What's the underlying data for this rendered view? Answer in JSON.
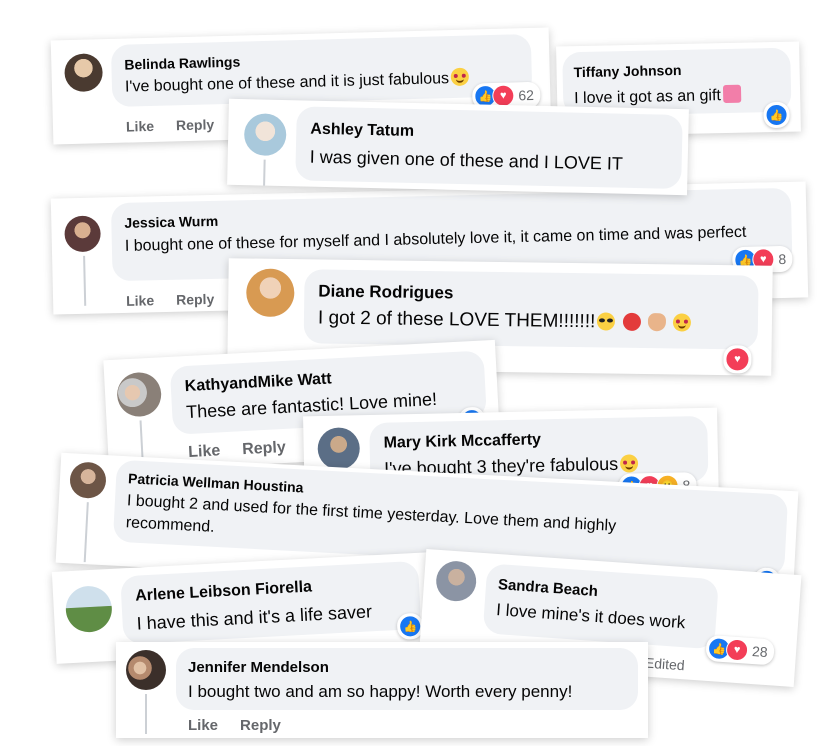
{
  "actions": {
    "like": "Like",
    "reply": "Reply"
  },
  "comments": [
    {
      "name": "Belinda Rawlings",
      "text": "I've bought one of these and it is just fabulous",
      "count": "62"
    },
    {
      "name": "Tiffany Johnson",
      "text": "I love it got as an gift"
    },
    {
      "name": "Ashley Tatum",
      "text": "I was given one of these and I LOVE IT"
    },
    {
      "name": "Jessica Wurm",
      "text": "I bought one of these for myself and I absolutely love it, it came on time and was perfect",
      "count": "8"
    },
    {
      "name": "Diane Rodrigues",
      "text": "I got 2 of these LOVE THEM!!!!!!!"
    },
    {
      "name": "KathyandMike Watt",
      "text": "These are fantastic! Love mine!"
    },
    {
      "name": "Mary Kirk Mccafferty",
      "text": "I've bought 3 they're fabulous",
      "count": "8"
    },
    {
      "name": "Patricia Wellman Houstina",
      "text": "I bought 2 and used for the first time yesterday. Love them and highly recommend."
    },
    {
      "name": "Arlene Leibson Fiorella",
      "text": "I have this and it's a life saver"
    },
    {
      "name": "Sandra Beach",
      "text": "I love mine's it does work",
      "count": "28",
      "edited": "Edited"
    },
    {
      "name": "Jennifer Mendelson",
      "text": "I bought two and am so happy! Worth every penny!"
    }
  ],
  "colors": {
    "like": "#1877f2",
    "love": "#f33e58",
    "wow": "#f7b125",
    "bubble": "#f0f2f5",
    "muted": "#65676b"
  }
}
